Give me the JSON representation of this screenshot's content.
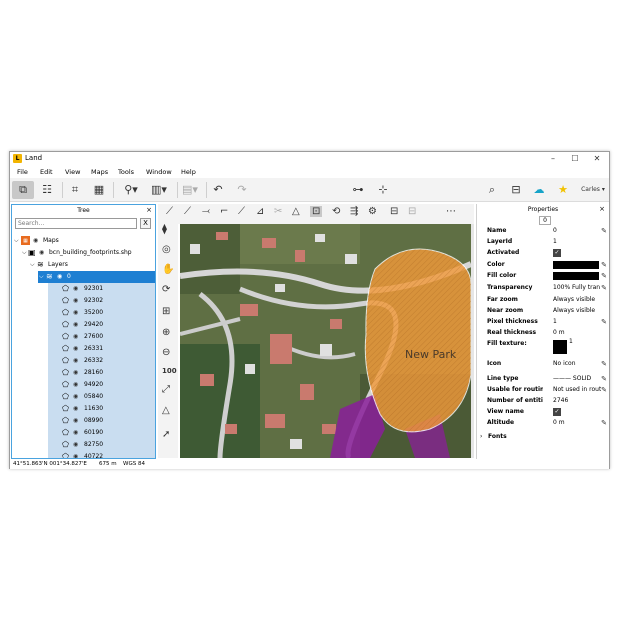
{
  "window": {
    "title": "Land",
    "app_icon": "land-app-icon",
    "controls": [
      "–",
      "☐",
      "✕"
    ]
  },
  "menu": [
    "File",
    "Edit",
    "View",
    "Maps",
    "Tools",
    "Window",
    "Help"
  ],
  "toolbar": {
    "user": "Carles",
    "user_chevron": "▾"
  },
  "tree": {
    "title": "Tree",
    "close": "×",
    "search_placeholder": "Search...",
    "clear_label": "X",
    "root": "Maps",
    "file": "bcn_building_footprints.shp",
    "layers_label": "Layers",
    "selected_layer": "0",
    "items": [
      "92301",
      "92302",
      "35200",
      "29420",
      "27600",
      "26331",
      "26332",
      "28160",
      "94920",
      "05840",
      "11630",
      "08990",
      "60190",
      "82750",
      "40722"
    ]
  },
  "map": {
    "label": "New Park",
    "colors": {
      "park": "#f29a3a",
      "purple": "#8a1f9a",
      "road": "#d9d9d9",
      "selection": "#ffffff"
    }
  },
  "properties": {
    "title": "Properties",
    "close": "×",
    "id": "0",
    "rows": [
      {
        "key": "Name",
        "value": "0"
      },
      {
        "key": "LayerId",
        "value": "1"
      },
      {
        "key": "Activated",
        "value": ""
      },
      {
        "key": "Color",
        "value": ""
      },
      {
        "key": "Fill color",
        "value": ""
      },
      {
        "key": "Transparency",
        "value": "100% Fully tran"
      },
      {
        "key": "Far zoom",
        "value": "Always visible"
      },
      {
        "key": "Near zoom",
        "value": "Always visible"
      },
      {
        "key": "Pixel thickness",
        "value": "1"
      },
      {
        "key": "Real thickness",
        "value": "0 m"
      },
      {
        "key": "Fill texture:",
        "value": "1"
      },
      {
        "key": "Icon",
        "value": "No icon"
      },
      {
        "key": "Line type",
        "value": "——— SOLID"
      },
      {
        "key": "Usable for routin",
        "value": "Not used in rout"
      },
      {
        "key": "Number of entitie",
        "value": "2746"
      },
      {
        "key": "View name",
        "value": ""
      },
      {
        "key": "Altitude",
        "value": "0 m"
      }
    ],
    "fonts_label": "Fonts",
    "checked_mark": "✓"
  },
  "status": {
    "coords": "41°51.863'N 001°34.827'E",
    "scale": "675 m",
    "datum": "WGS 84"
  }
}
